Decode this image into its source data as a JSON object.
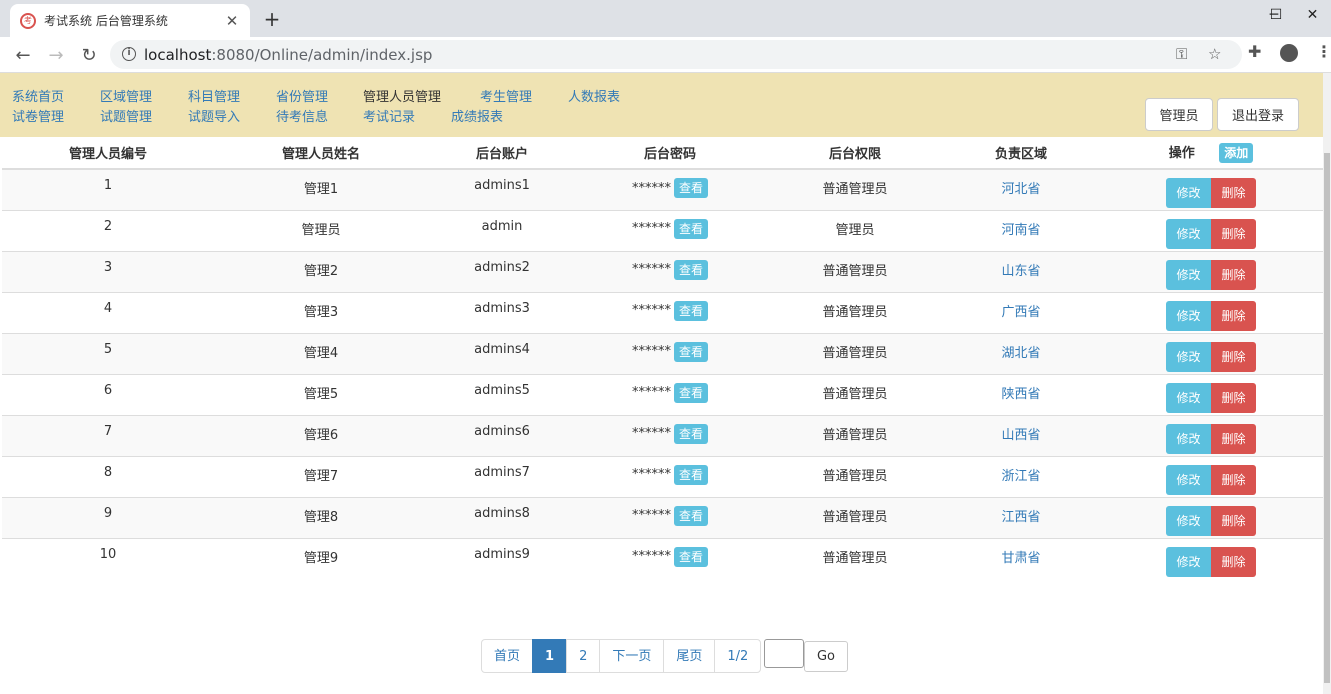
{
  "browser": {
    "tab_title": "考试系统 后台管理系统",
    "url_host": "localhost",
    "url_rest": ":8080/Online/admin/index.jsp",
    "favicon_glyph": "考"
  },
  "nav": {
    "row1": [
      "系统首页",
      "区域管理",
      "科目管理",
      "省份管理",
      "管理人员管理",
      "考生管理",
      "人数报表"
    ],
    "row2": [
      "试卷管理",
      "试题管理",
      "试题导入",
      "待考信息",
      "考试记录",
      "成绩报表"
    ],
    "active": "管理人员管理",
    "user_label": "管理员",
    "logout_label": "退出登录"
  },
  "table": {
    "headers": [
      "管理人员编号",
      "管理人员姓名",
      "后台账户",
      "后台密码",
      "后台权限",
      "负责区域",
      "操作"
    ],
    "add_label": "添加",
    "view_label": "查看",
    "edit_label": "修改",
    "delete_label": "删除",
    "rows": [
      {
        "id": "1",
        "name": "管理1",
        "account": "admins1",
        "password": "******",
        "role": "普通管理员",
        "region": "河北省"
      },
      {
        "id": "2",
        "name": "管理员",
        "account": "admin",
        "password": "******",
        "role": "管理员",
        "region": "河南省"
      },
      {
        "id": "3",
        "name": "管理2",
        "account": "admins2",
        "password": "******",
        "role": "普通管理员",
        "region": "山东省"
      },
      {
        "id": "4",
        "name": "管理3",
        "account": "admins3",
        "password": "******",
        "role": "普通管理员",
        "region": "广西省"
      },
      {
        "id": "5",
        "name": "管理4",
        "account": "admins4",
        "password": "******",
        "role": "普通管理员",
        "region": "湖北省"
      },
      {
        "id": "6",
        "name": "管理5",
        "account": "admins5",
        "password": "******",
        "role": "普通管理员",
        "region": "陕西省"
      },
      {
        "id": "7",
        "name": "管理6",
        "account": "admins6",
        "password": "******",
        "role": "普通管理员",
        "region": "山西省"
      },
      {
        "id": "8",
        "name": "管理7",
        "account": "admins7",
        "password": "******",
        "role": "普通管理员",
        "region": "浙江省"
      },
      {
        "id": "9",
        "name": "管理8",
        "account": "admins8",
        "password": "******",
        "role": "普通管理员",
        "region": "江西省"
      },
      {
        "id": "10",
        "name": "管理9",
        "account": "admins9",
        "password": "******",
        "role": "普通管理员",
        "region": "甘肃省"
      }
    ]
  },
  "pager": {
    "first": "首页",
    "pages": [
      "1",
      "2"
    ],
    "current": "1",
    "next": "下一页",
    "last": "尾页",
    "status": "1/2",
    "go_label": "Go"
  },
  "colors": {
    "nav_bg": "#efe3b3",
    "link": "#337ab7",
    "info": "#5bc0de",
    "danger": "#d9534f"
  }
}
